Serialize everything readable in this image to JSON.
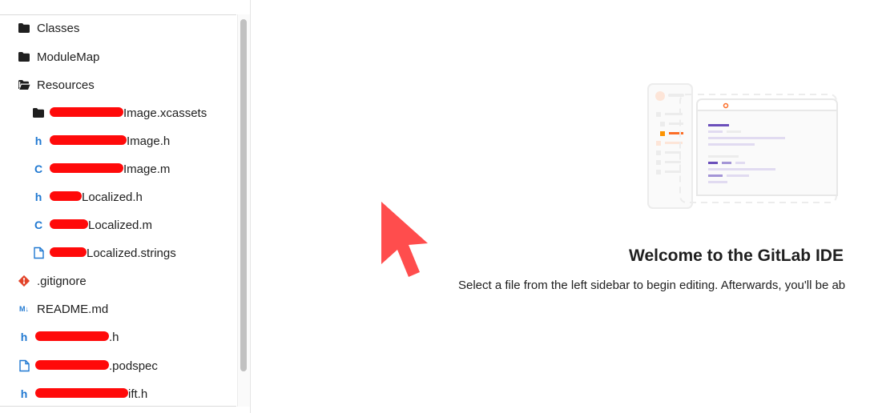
{
  "sidebar": {
    "items": [
      {
        "type": "folder-closed",
        "label": "Classes"
      },
      {
        "type": "folder-closed",
        "label": "ModuleMap"
      },
      {
        "type": "folder-open",
        "label": "Resources"
      },
      {
        "type": "folder-closed",
        "label": "Image.xcassets",
        "redacted": true
      },
      {
        "type": "h",
        "label": "Image.h",
        "redacted": true
      },
      {
        "type": "c",
        "label": "Image.m",
        "redacted": true
      },
      {
        "type": "h",
        "label": "Localized.h",
        "redacted": true
      },
      {
        "type": "c",
        "label": "Localized.m",
        "redacted": true
      },
      {
        "type": "file",
        "label": "Localized.strings",
        "redacted": true
      },
      {
        "type": "git",
        "label": ".gitignore"
      },
      {
        "type": "md",
        "label": "README.md"
      },
      {
        "type": "h",
        "label": ".h",
        "redacted": true
      },
      {
        "type": "file",
        "label": ".podspec",
        "redacted": true
      },
      {
        "type": "h",
        "label": "ift.h",
        "redacted": true
      }
    ]
  },
  "icons": {
    "folder_closed": "folder-icon",
    "folder_open": "folder-open-icon",
    "h": "header-file-icon",
    "c": "c-file-icon",
    "file": "file-icon",
    "git": "git-icon",
    "md": "markdown-icon"
  },
  "icon_glyphs": {
    "h": "h",
    "c": "C",
    "md": "M↓"
  },
  "welcome": {
    "title": "Welcome to the GitLab IDE",
    "description": "Select a file from the left sidebar to begin editing. Afterwards, you'll be ab"
  },
  "colors": {
    "redaction": "#ff0a0a",
    "cursor": "#ff4d4d",
    "file_icon_blue": "#1f78d1",
    "git_orange": "#e24329",
    "illustration_purple": "#6b4fbb"
  }
}
